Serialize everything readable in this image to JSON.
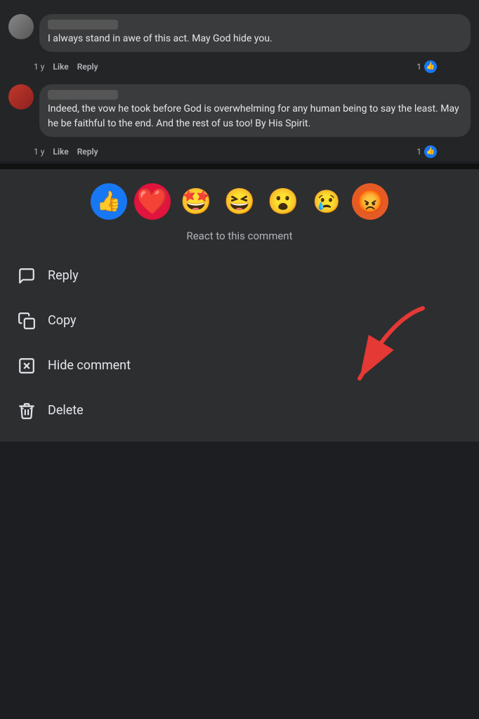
{
  "comments": [
    {
      "id": 1,
      "authorBlurred": true,
      "text": "I always stand in awe of this act. May God hide you.",
      "time": "1 y",
      "likeCount": "1",
      "avatarColor": "gray"
    },
    {
      "id": 2,
      "authorBlurred": true,
      "text": "Indeed, the vow he took before God is overwhelming for any human being to say the least. May he be faithful to the end. And the rest of us too! By His Spirit.",
      "time": "1 y",
      "likeCount": "1",
      "avatarColor": "red"
    }
  ],
  "reactions": {
    "label": "React to this comment",
    "emojis": [
      {
        "id": "like",
        "emoji": "👍",
        "label": "Like",
        "special": "like"
      },
      {
        "id": "love",
        "emoji": "❤️",
        "label": "Love",
        "special": "love"
      },
      {
        "id": "haha",
        "emoji": "😆",
        "label": "Haha"
      },
      {
        "id": "wow",
        "emoji": "😮",
        "label": "Wow"
      },
      {
        "id": "sad",
        "emoji": "😢",
        "label": "Sad"
      },
      {
        "id": "angry",
        "emoji": "😡",
        "label": "Angry"
      }
    ]
  },
  "menu": {
    "items": [
      {
        "id": "reply",
        "label": "Reply",
        "icon": "reply"
      },
      {
        "id": "copy",
        "label": "Copy",
        "icon": "copy"
      },
      {
        "id": "hide",
        "label": "Hide comment",
        "icon": "hide"
      },
      {
        "id": "delete",
        "label": "Delete",
        "icon": "delete"
      }
    ]
  },
  "actions": {
    "like": "Like",
    "reply": "Reply"
  }
}
